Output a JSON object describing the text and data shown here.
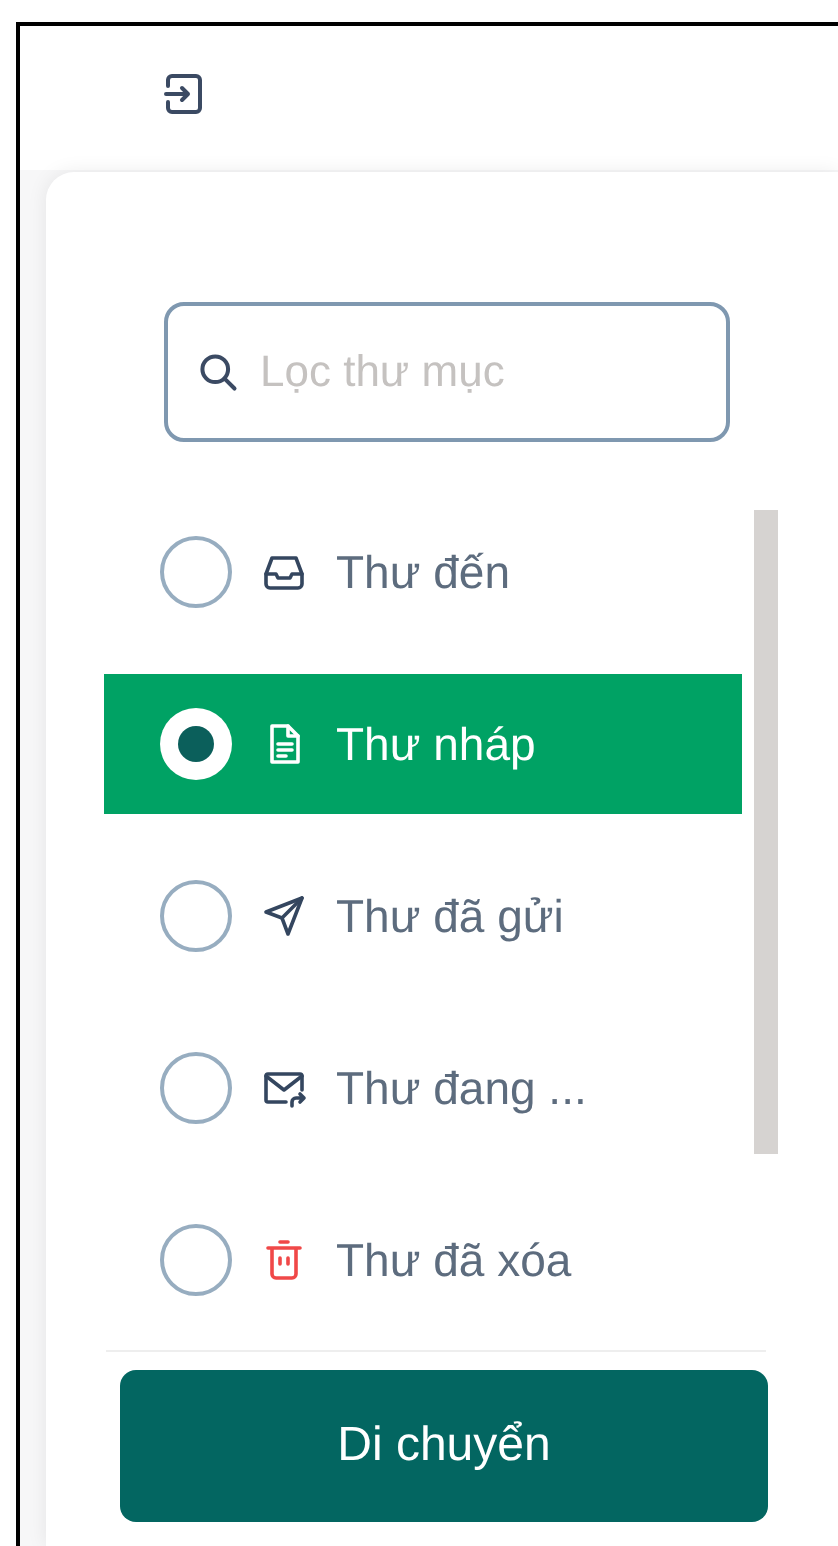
{
  "search": {
    "placeholder": "Lọc thư mục"
  },
  "folders": [
    {
      "kind": "inbox",
      "label": "Thư đến",
      "selected": false
    },
    {
      "kind": "draft",
      "label": "Thư nháp",
      "selected": true
    },
    {
      "kind": "sent",
      "label": "Thư đã gửi",
      "selected": false
    },
    {
      "kind": "outbox",
      "label": "Thư đang ...",
      "selected": false
    },
    {
      "kind": "trash",
      "label": "Thư đã xóa",
      "selected": false
    }
  ],
  "button": "Di chuyển"
}
